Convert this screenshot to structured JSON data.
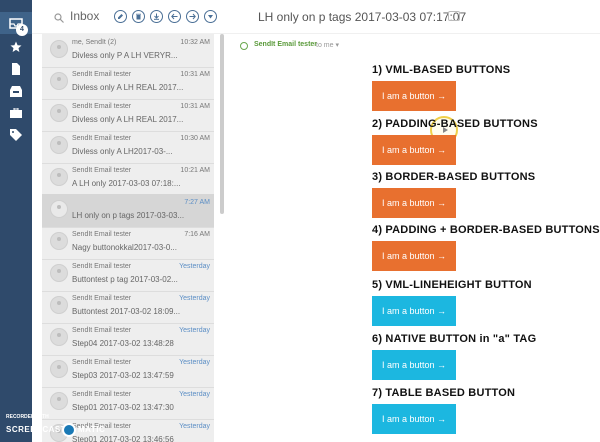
{
  "rail": {
    "badge": "4",
    "icons": [
      "inbox-icon",
      "star-icon",
      "document-icon",
      "archive-icon",
      "briefcase-icon",
      "tag-icon"
    ]
  },
  "header": {
    "inbox_label": "Inbox",
    "subject": "LH only on p tags 2017-03-03 07:17:07"
  },
  "messages": [
    {
      "sender": "me, SendIt (2)",
      "time": "10:32 AM",
      "preview": "Divless only P A LH VERYR...",
      "selected": false,
      "time_blue": false
    },
    {
      "sender": "SendIt Email tester",
      "time": "10:31 AM",
      "preview": "Divless only A LH REAL 2017...",
      "selected": false,
      "time_blue": false
    },
    {
      "sender": "SendIt Email tester",
      "time": "10:31 AM",
      "preview": "Divless only A LH REAL 2017...",
      "selected": false,
      "time_blue": false
    },
    {
      "sender": "SendIt Email tester",
      "time": "10:30 AM",
      "preview": "Divless only A LH2017-03-...",
      "selected": false,
      "time_blue": false
    },
    {
      "sender": "SendIt Email tester",
      "time": "10:21 AM",
      "preview": "A LH only 2017-03-03 07:18:...",
      "selected": false,
      "time_blue": false
    },
    {
      "sender": "",
      "time": "7:27 AM",
      "preview": "LH only on p tags 2017-03-03...",
      "selected": true,
      "time_blue": true
    },
    {
      "sender": "SendIt Email tester",
      "time": "7:16 AM",
      "preview": "Nagy buttonokkal2017-03-0...",
      "selected": false,
      "time_blue": false
    },
    {
      "sender": "SendIt Email tester",
      "time": "Yesterday",
      "preview": "Buttontest p tag 2017-03-02...",
      "selected": false,
      "time_blue": true
    },
    {
      "sender": "SendIt Email tester",
      "time": "Yesterday",
      "preview": "Buttontest 2017-03-02 18:09...",
      "selected": false,
      "time_blue": true
    },
    {
      "sender": "SendIt Email tester",
      "time": "Yesterday",
      "preview": "Step04 2017-03-02 13:48:28",
      "selected": false,
      "time_blue": true
    },
    {
      "sender": "SendIt Email tester",
      "time": "Yesterday",
      "preview": "Step03 2017-03-02 13:47:59",
      "selected": false,
      "time_blue": true
    },
    {
      "sender": "SendIt Email tester",
      "time": "Yesterday",
      "preview": "Step01 2017-03-02 13:47:30",
      "selected": false,
      "time_blue": true
    },
    {
      "sender": "SendIt Email tester",
      "time": "Yesterday",
      "preview": "Step01 2017-03-02 13:46:56",
      "selected": false,
      "time_blue": true
    }
  ],
  "reading": {
    "from": "SendIt Email tester",
    "to": "to me ▾",
    "sections": [
      {
        "heading": "1) VML-BASED BUTTONS",
        "button": "I am a button →",
        "color": "#e8702f"
      },
      {
        "heading": "2) PADDING-BASED BUTTONS",
        "button": "I am a button →",
        "color": "#e8702f"
      },
      {
        "heading": "3) BORDER-BASED BUTTONS",
        "button": "I am a button →",
        "color": "#e8702f"
      },
      {
        "heading": "4) PADDING + BORDER-BASED BUTTONS",
        "button": "I am a button →",
        "color": "#e8702f"
      },
      {
        "heading": "5) VML-LINEHEIGHT BUTTON",
        "button": "I am a button →",
        "color": "#1cb7e0"
      },
      {
        "heading": "6) NATIVE BUTTON in \"a\" TAG",
        "button": "I am a button →",
        "color": "#1cb7e0"
      },
      {
        "heading": "7) TABLE BASED BUTTON",
        "button": "I am a button →",
        "color": "#1cb7e0"
      }
    ]
  },
  "watermark": {
    "line1": "RECORDED WITH",
    "line2a": "SCREENCAST",
    "line2b": "MATIC"
  }
}
